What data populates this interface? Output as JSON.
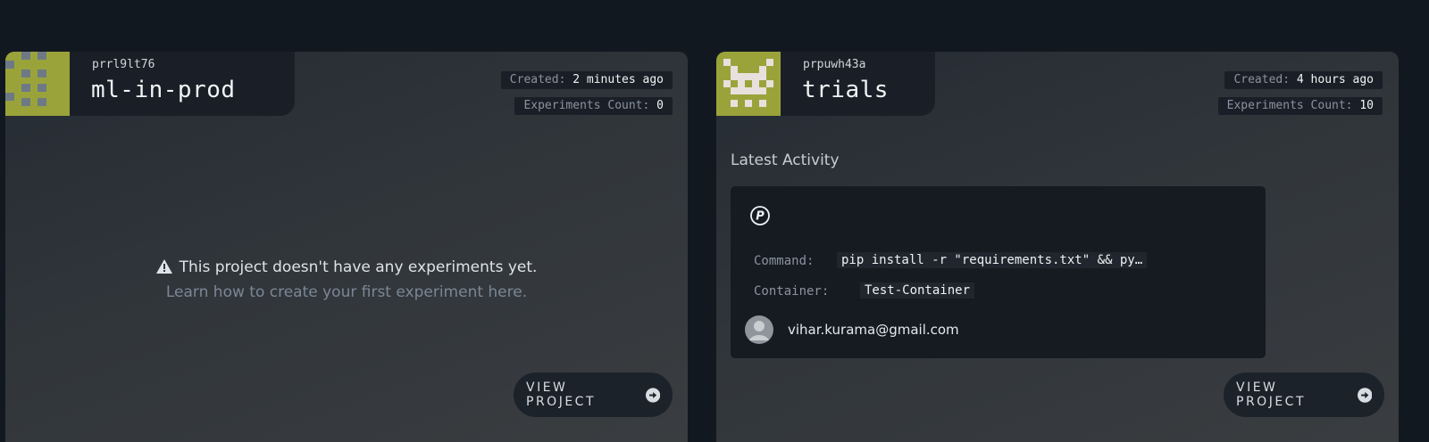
{
  "projects": [
    {
      "id": "prrl9lt76",
      "name": "ml-in-prod",
      "created_label": "Created:",
      "created_value": "2 minutes ago",
      "count_label": "Experiments Count:",
      "count_value": "0",
      "empty_message": "This project doesn't have any experiments yet.",
      "empty_link": "Learn how to create your first experiment here.",
      "button_label": "VIEW PROJECT"
    },
    {
      "id": "prpuwh43a",
      "name": "trials",
      "created_label": "Created:",
      "created_value": "4 hours ago",
      "count_label": "Experiments Count:",
      "count_value": "10",
      "latest_activity_label": "Latest Activity",
      "activity": {
        "command_label": "Command:",
        "command_value": "pip install -r \"requirements.txt\" && py…",
        "container_label": "Container:",
        "container_value": "Test-Container",
        "user_email": "vihar.kurama@gmail.com"
      },
      "button_label": "VIEW PROJECT"
    }
  ],
  "colors": {
    "background": "#121820",
    "card": "#30353a",
    "avatar_left": "#9aa33a",
    "avatar_right": "#9aa33a",
    "link": "#7a8796"
  },
  "icons": [
    "warning-icon",
    "arrow-circle-right-icon",
    "paperspace-logo-icon",
    "user-avatar-icon"
  ]
}
